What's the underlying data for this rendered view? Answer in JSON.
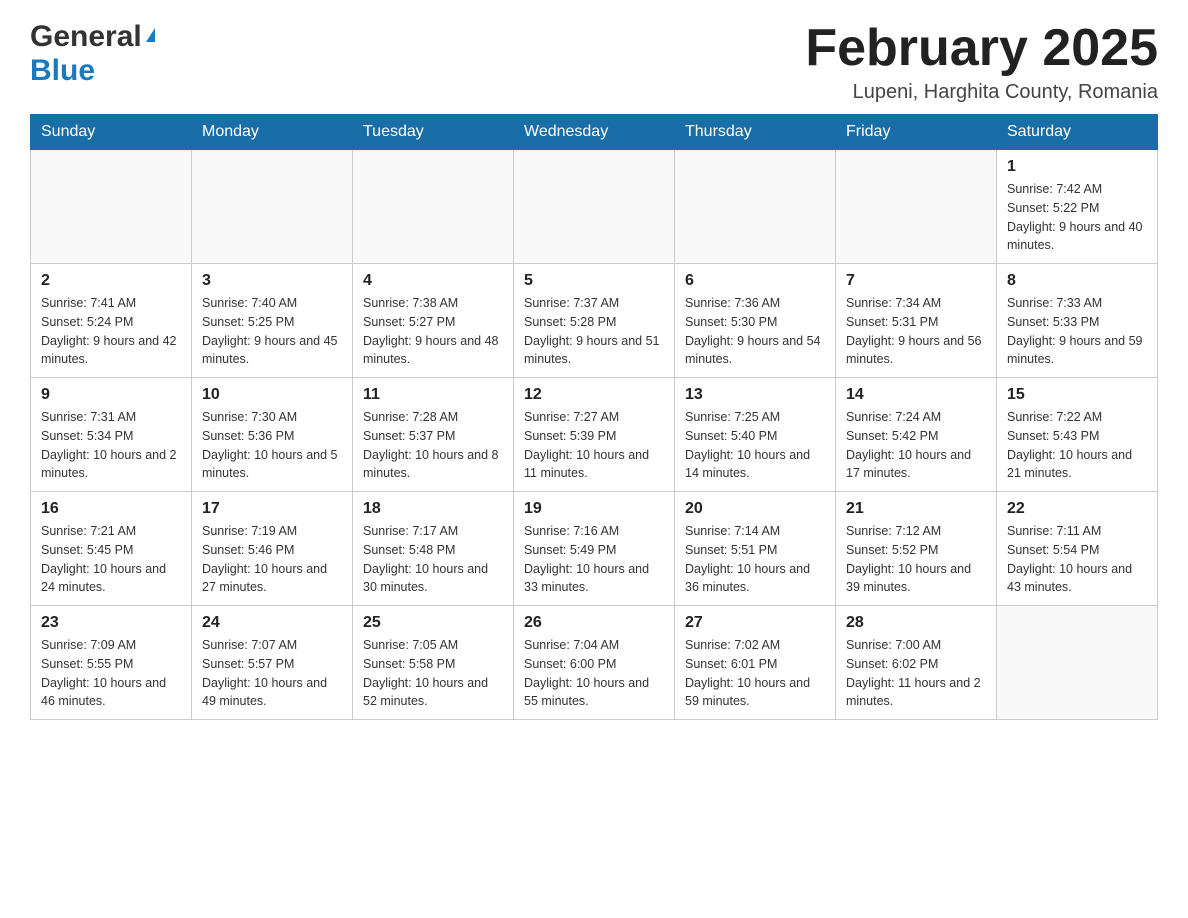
{
  "logo": {
    "general": "General",
    "triangle": "▶",
    "blue": "Blue"
  },
  "title": "February 2025",
  "subtitle": "Lupeni, Harghita County, Romania",
  "weekdays": [
    "Sunday",
    "Monday",
    "Tuesday",
    "Wednesday",
    "Thursday",
    "Friday",
    "Saturday"
  ],
  "weeks": [
    [
      {
        "day": "",
        "info": ""
      },
      {
        "day": "",
        "info": ""
      },
      {
        "day": "",
        "info": ""
      },
      {
        "day": "",
        "info": ""
      },
      {
        "day": "",
        "info": ""
      },
      {
        "day": "",
        "info": ""
      },
      {
        "day": "1",
        "info": "Sunrise: 7:42 AM\nSunset: 5:22 PM\nDaylight: 9 hours and 40 minutes."
      }
    ],
    [
      {
        "day": "2",
        "info": "Sunrise: 7:41 AM\nSunset: 5:24 PM\nDaylight: 9 hours and 42 minutes."
      },
      {
        "day": "3",
        "info": "Sunrise: 7:40 AM\nSunset: 5:25 PM\nDaylight: 9 hours and 45 minutes."
      },
      {
        "day": "4",
        "info": "Sunrise: 7:38 AM\nSunset: 5:27 PM\nDaylight: 9 hours and 48 minutes."
      },
      {
        "day": "5",
        "info": "Sunrise: 7:37 AM\nSunset: 5:28 PM\nDaylight: 9 hours and 51 minutes."
      },
      {
        "day": "6",
        "info": "Sunrise: 7:36 AM\nSunset: 5:30 PM\nDaylight: 9 hours and 54 minutes."
      },
      {
        "day": "7",
        "info": "Sunrise: 7:34 AM\nSunset: 5:31 PM\nDaylight: 9 hours and 56 minutes."
      },
      {
        "day": "8",
        "info": "Sunrise: 7:33 AM\nSunset: 5:33 PM\nDaylight: 9 hours and 59 minutes."
      }
    ],
    [
      {
        "day": "9",
        "info": "Sunrise: 7:31 AM\nSunset: 5:34 PM\nDaylight: 10 hours and 2 minutes."
      },
      {
        "day": "10",
        "info": "Sunrise: 7:30 AM\nSunset: 5:36 PM\nDaylight: 10 hours and 5 minutes."
      },
      {
        "day": "11",
        "info": "Sunrise: 7:28 AM\nSunset: 5:37 PM\nDaylight: 10 hours and 8 minutes."
      },
      {
        "day": "12",
        "info": "Sunrise: 7:27 AM\nSunset: 5:39 PM\nDaylight: 10 hours and 11 minutes."
      },
      {
        "day": "13",
        "info": "Sunrise: 7:25 AM\nSunset: 5:40 PM\nDaylight: 10 hours and 14 minutes."
      },
      {
        "day": "14",
        "info": "Sunrise: 7:24 AM\nSunset: 5:42 PM\nDaylight: 10 hours and 17 minutes."
      },
      {
        "day": "15",
        "info": "Sunrise: 7:22 AM\nSunset: 5:43 PM\nDaylight: 10 hours and 21 minutes."
      }
    ],
    [
      {
        "day": "16",
        "info": "Sunrise: 7:21 AM\nSunset: 5:45 PM\nDaylight: 10 hours and 24 minutes."
      },
      {
        "day": "17",
        "info": "Sunrise: 7:19 AM\nSunset: 5:46 PM\nDaylight: 10 hours and 27 minutes."
      },
      {
        "day": "18",
        "info": "Sunrise: 7:17 AM\nSunset: 5:48 PM\nDaylight: 10 hours and 30 minutes."
      },
      {
        "day": "19",
        "info": "Sunrise: 7:16 AM\nSunset: 5:49 PM\nDaylight: 10 hours and 33 minutes."
      },
      {
        "day": "20",
        "info": "Sunrise: 7:14 AM\nSunset: 5:51 PM\nDaylight: 10 hours and 36 minutes."
      },
      {
        "day": "21",
        "info": "Sunrise: 7:12 AM\nSunset: 5:52 PM\nDaylight: 10 hours and 39 minutes."
      },
      {
        "day": "22",
        "info": "Sunrise: 7:11 AM\nSunset: 5:54 PM\nDaylight: 10 hours and 43 minutes."
      }
    ],
    [
      {
        "day": "23",
        "info": "Sunrise: 7:09 AM\nSunset: 5:55 PM\nDaylight: 10 hours and 46 minutes."
      },
      {
        "day": "24",
        "info": "Sunrise: 7:07 AM\nSunset: 5:57 PM\nDaylight: 10 hours and 49 minutes."
      },
      {
        "day": "25",
        "info": "Sunrise: 7:05 AM\nSunset: 5:58 PM\nDaylight: 10 hours and 52 minutes."
      },
      {
        "day": "26",
        "info": "Sunrise: 7:04 AM\nSunset: 6:00 PM\nDaylight: 10 hours and 55 minutes."
      },
      {
        "day": "27",
        "info": "Sunrise: 7:02 AM\nSunset: 6:01 PM\nDaylight: 10 hours and 59 minutes."
      },
      {
        "day": "28",
        "info": "Sunrise: 7:00 AM\nSunset: 6:02 PM\nDaylight: 11 hours and 2 minutes."
      },
      {
        "day": "",
        "info": ""
      }
    ]
  ]
}
